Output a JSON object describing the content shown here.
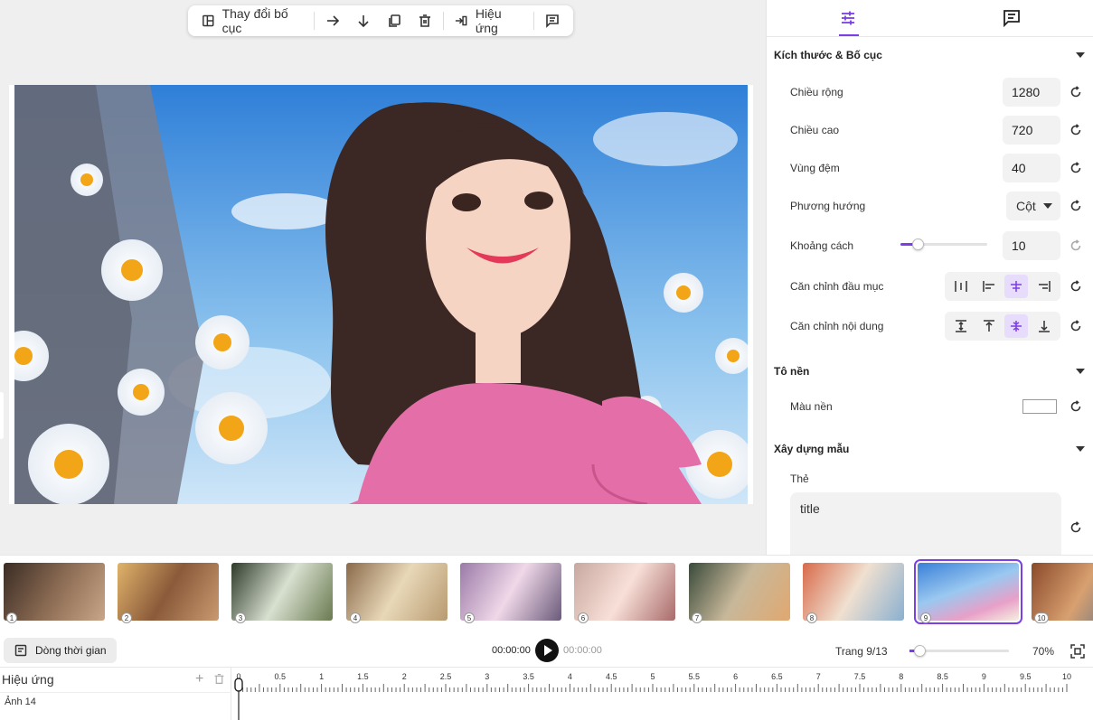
{
  "toolbar": {
    "change_layout": "Thay đổi bố cục",
    "effects": "Hiệu ứng"
  },
  "panel": {
    "tabs": [
      "settings-sliders-icon",
      "comment-icon"
    ],
    "size_section": {
      "title": "Kích thước & Bố cục",
      "width_label": "Chiều rộng",
      "width": "1280",
      "height_label": "Chiều cao",
      "height": "720",
      "padding_label": "Vùng đệm",
      "padding": "40",
      "direction_label": "Phương hướng",
      "direction": "Cột",
      "spacing_label": "Khoảng cách",
      "spacing": "10",
      "spacing_level": 0.2,
      "header_align_label": "Căn chỉnh đầu mục",
      "content_align_label": "Căn chỉnh nội dung"
    },
    "fill_section": {
      "title": "Tô nền",
      "bg_color_label": "Màu nền",
      "bg_color": "#ffffff"
    },
    "template_section": {
      "title": "Xây dựng mẫu",
      "tag_label": "Thẻ",
      "tag_value": "title"
    }
  },
  "thumbnails": [
    "1",
    "2",
    "3",
    "4",
    "5",
    "6",
    "7",
    "8",
    "9",
    "10"
  ],
  "timeline": {
    "button_label": "Dòng thời gian",
    "time_current": "00:00:00",
    "time_total": "00:00:00",
    "page_info": "Trang 9/13",
    "zoom": "70%",
    "zoom_level": 0.1,
    "effects_label": "Hiệu ứng",
    "add_symbol": "+",
    "track_name": "Ảnh 14",
    "ruler_labels": [
      "0",
      "0.5",
      "1",
      "1.5",
      "2",
      "2.5",
      "3",
      "3.5",
      "4",
      "4.5",
      "5",
      "5.5",
      "6",
      "6.5",
      "7",
      "7.5",
      "8",
      "8.5",
      "9",
      "9.5",
      "10"
    ]
  },
  "colors": {
    "accent": "#7b3fe4",
    "panel_bg": "#ffffff",
    "canvas_bg": "#efefef"
  }
}
